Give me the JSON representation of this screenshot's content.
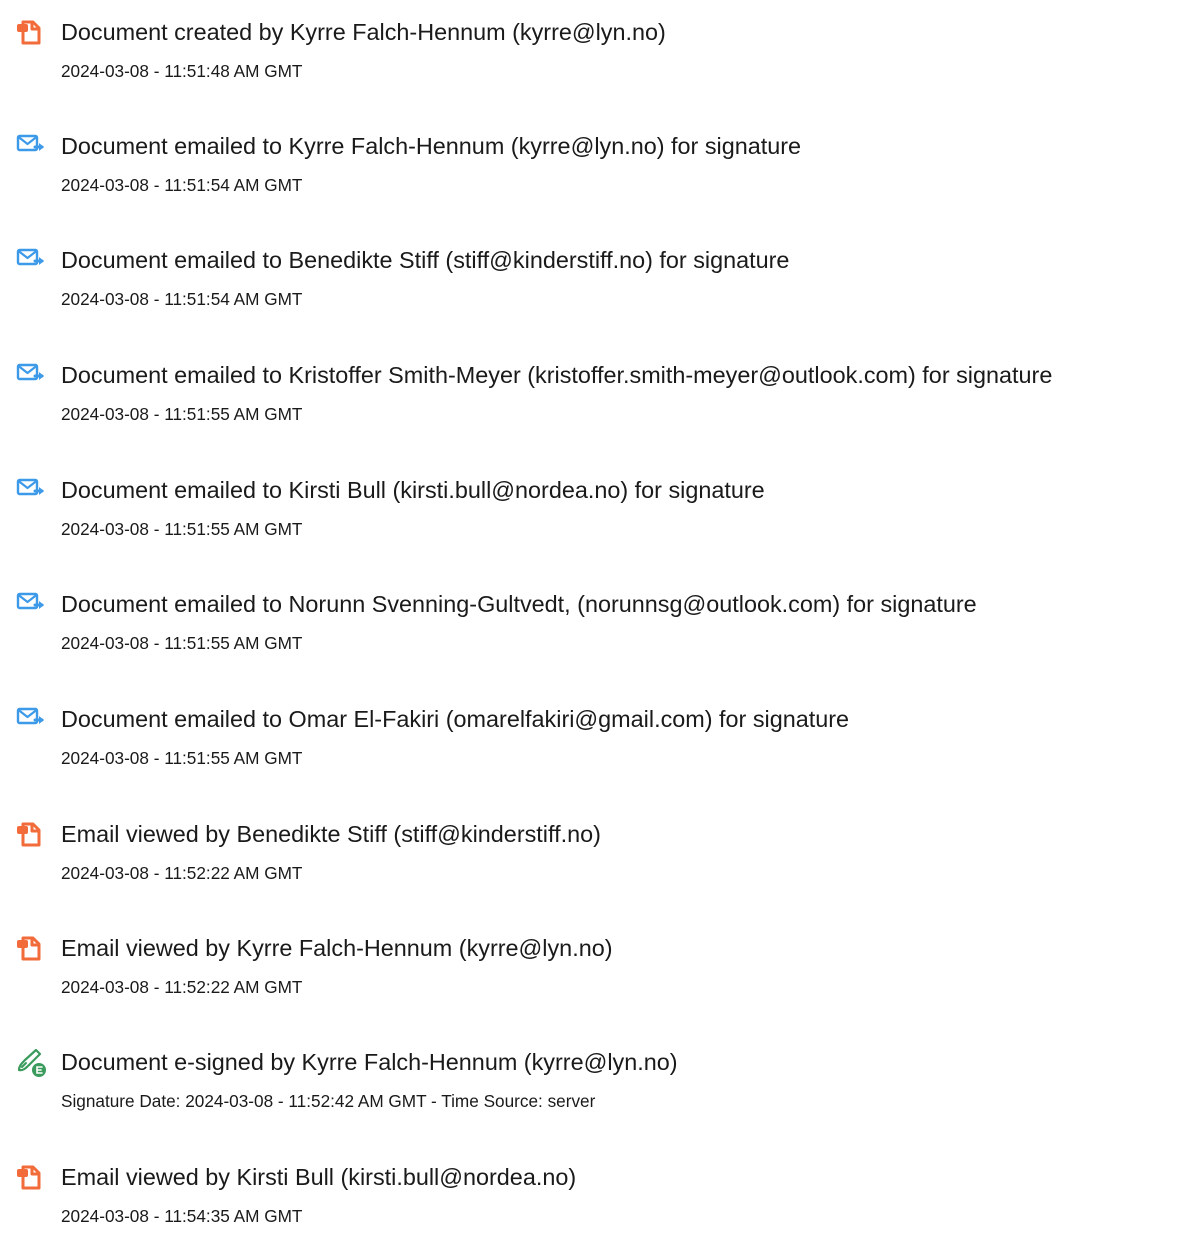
{
  "colors": {
    "doc_icon": "#f26b3a",
    "mail_icon": "#3d9ae8",
    "sign_icon": "#3a9b5c",
    "text": "#1a1a1a"
  },
  "events": [
    {
      "icon": "document-icon",
      "title": "Document created by Kyrre Falch-Hennum (kyrre@lyn.no)",
      "timestamp": "2024-03-08 - 11:51:48 AM GMT"
    },
    {
      "icon": "email-sent-icon",
      "title": "Document emailed to Kyrre Falch-Hennum (kyrre@lyn.no) for signature",
      "timestamp": "2024-03-08 - 11:51:54 AM GMT"
    },
    {
      "icon": "email-sent-icon",
      "title": "Document emailed to Benedikte Stiff (stiff@kinderstiff.no) for signature",
      "timestamp": "2024-03-08 - 11:51:54 AM GMT"
    },
    {
      "icon": "email-sent-icon",
      "title": "Document emailed to Kristoffer Smith-Meyer (kristoffer.smith-meyer@outlook.com) for signature",
      "timestamp": "2024-03-08 - 11:51:55 AM GMT"
    },
    {
      "icon": "email-sent-icon",
      "title": "Document emailed to Kirsti Bull (kirsti.bull@nordea.no) for signature",
      "timestamp": "2024-03-08 - 11:51:55 AM GMT"
    },
    {
      "icon": "email-sent-icon",
      "title": "Document emailed to Norunn Svenning-Gultvedt, (norunnsg@outlook.com) for signature",
      "timestamp": "2024-03-08 - 11:51:55 AM GMT"
    },
    {
      "icon": "email-sent-icon",
      "title": "Document emailed to Omar El-Fakiri (omarelfakiri@gmail.com) for signature",
      "timestamp": "2024-03-08 - 11:51:55 AM GMT"
    },
    {
      "icon": "document-icon",
      "title": "Email viewed by Benedikte Stiff (stiff@kinderstiff.no)",
      "timestamp": "2024-03-08 - 11:52:22 AM GMT"
    },
    {
      "icon": "document-icon",
      "title": "Email viewed by Kyrre Falch-Hennum (kyrre@lyn.no)",
      "timestamp": "2024-03-08 - 11:52:22 AM GMT"
    },
    {
      "icon": "e-sign-icon",
      "title": "Document e-signed by Kyrre Falch-Hennum (kyrre@lyn.no)",
      "timestamp": "Signature Date: 2024-03-08 - 11:52:42 AM GMT - Time Source: server"
    },
    {
      "icon": "document-icon",
      "title": "Email viewed by Kirsti Bull (kirsti.bull@nordea.no)",
      "timestamp": "2024-03-08 - 11:54:35 AM GMT"
    }
  ]
}
